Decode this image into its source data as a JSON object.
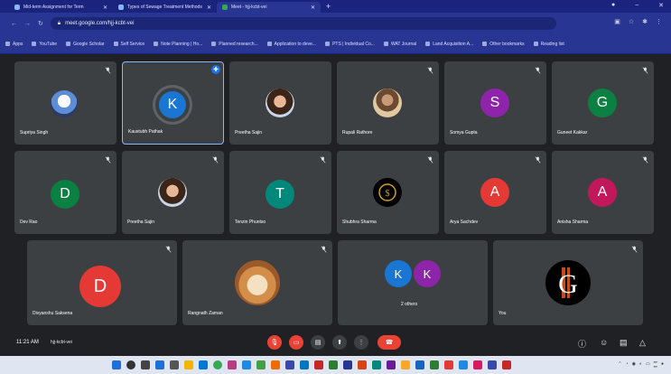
{
  "browser": {
    "tabs": [
      {
        "title": "Mid-term Assignment for Term",
        "close": "✕"
      },
      {
        "title": "Types of Sewage Treatment Methods",
        "close": "✕"
      },
      {
        "title": "Meet - hjj-kcbt-vei",
        "close": "✕"
      }
    ],
    "new_tab": "+",
    "url": "meet.google.com/hjj-kcbt-vei",
    "bookmarks": [
      "Apps",
      "YouTube",
      "Google Scholar",
      "Self Service",
      "Note Planning | Ho...",
      "Planned research...",
      "Application to deve...",
      "PTS | Individual Co...",
      "WAT Journal",
      "Land Acquisition A...",
      "Other bookmarks",
      "Reading list"
    ]
  },
  "participants": [
    {
      "name": "Supriya Singh"
    },
    {
      "name": "Kaustubh Pathak",
      "initial": "K",
      "color": "#1976d2"
    },
    {
      "name": "Preetha Sajin"
    },
    {
      "name": "Rupali Rathore"
    },
    {
      "name": "Somya Gupta",
      "initial": "S",
      "color": "#8e24aa"
    },
    {
      "name": "Guneet Kakkar",
      "initial": "G",
      "color": "#0b8043"
    },
    {
      "name": "Dev Rao",
      "initial": "D",
      "color": "#0b8043"
    },
    {
      "name": "Preetha Sajin"
    },
    {
      "name": "Tenzin Phuntso",
      "initial": "T",
      "color": "#00897b"
    },
    {
      "name": "Shubhra Sharma"
    },
    {
      "name": "Arya Sachdev",
      "initial": "A",
      "color": "#e53935"
    },
    {
      "name": "Anisha Sharma",
      "initial": "A",
      "color": "#c2185b"
    },
    {
      "name": "Divyanshu Saksena",
      "initial": "D",
      "color": "#e53935"
    },
    {
      "name": "Rangnath Zaman"
    },
    {
      "name": "2 others",
      "initials": [
        "K",
        "K"
      ],
      "colors": [
        "#1976d2",
        "#8e24aa"
      ]
    },
    {
      "name": "You"
    }
  ],
  "meeting": {
    "time": "11:21 AM",
    "code": "hjj-kcbt-vei"
  },
  "colors": {
    "end_call": "#ea4335",
    "control_off": "#ea4335",
    "control": "#3c4043"
  }
}
